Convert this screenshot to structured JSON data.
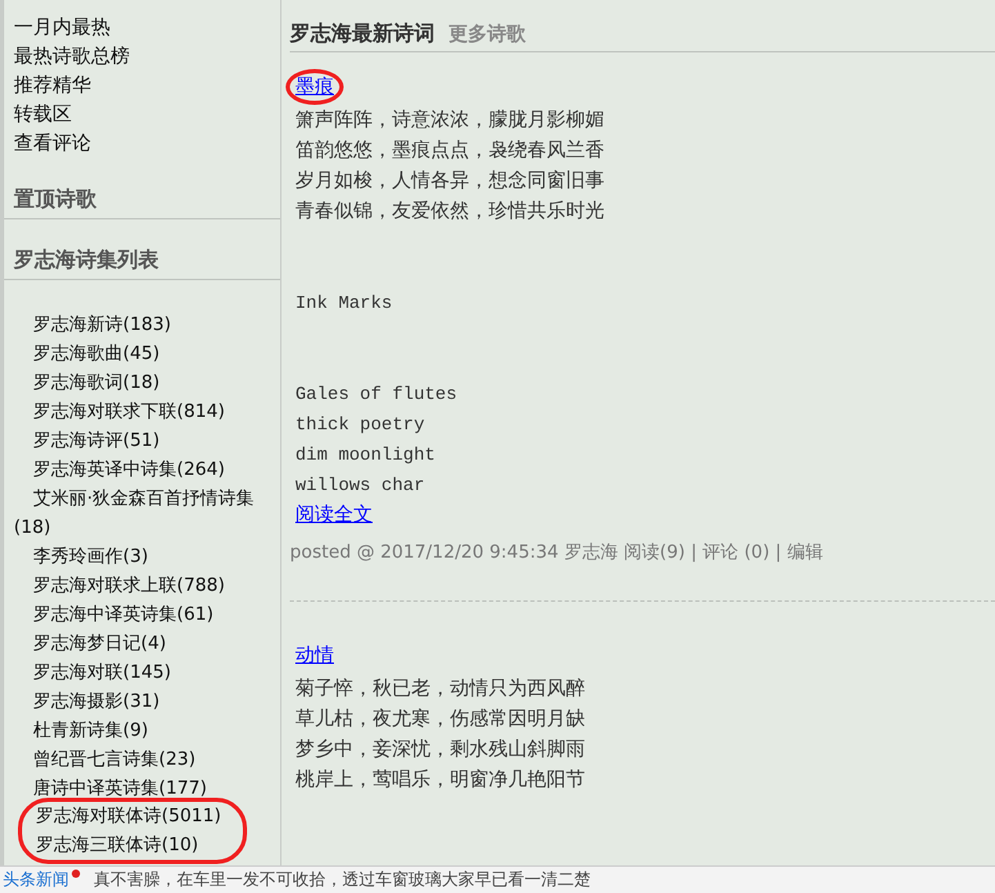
{
  "sidebar": {
    "links": [
      {
        "label": "一月内最热"
      },
      {
        "label": "最热诗歌总榜"
      },
      {
        "label": "推荐精华"
      },
      {
        "label": "转载区"
      },
      {
        "label": "查看评论"
      }
    ],
    "sections": [
      {
        "title": "置顶诗歌"
      },
      {
        "title": "罗志海诗集列表"
      }
    ],
    "collections": [
      {
        "label": "罗志海新诗(183)",
        "circled": false
      },
      {
        "label": "罗志海歌曲(45)",
        "circled": false
      },
      {
        "label": "罗志海歌词(18)",
        "circled": false
      },
      {
        "label": "罗志海对联求下联(814)",
        "circled": false
      },
      {
        "label": "罗志海诗评(51)",
        "circled": false
      },
      {
        "label": "罗志海英译中诗集(264)",
        "circled": false
      },
      {
        "label": "艾米丽·狄金森百首抒情诗集(18)",
        "circled": false
      },
      {
        "label": "李秀玲画作(3)",
        "circled": false
      },
      {
        "label": "罗志海对联求上联(788)",
        "circled": false
      },
      {
        "label": "罗志海中译英诗集(61)",
        "circled": false
      },
      {
        "label": "罗志海梦日记(4)",
        "circled": false
      },
      {
        "label": "罗志海对联(145)",
        "circled": false
      },
      {
        "label": "罗志海摄影(31)",
        "circled": false
      },
      {
        "label": "杜青新诗集(9)",
        "circled": false
      },
      {
        "label": "曾纪晋七言诗集(23)",
        "circled": false
      },
      {
        "label": "唐诗中译英诗集(177)",
        "circled": false
      },
      {
        "label": "罗志海对联体诗(5011)",
        "circled": true
      },
      {
        "label": "罗志海三联体诗(10)",
        "circled": true
      }
    ]
  },
  "main": {
    "heading": "罗志海最新诗词",
    "more": "更多诗歌",
    "posts": [
      {
        "title": "墨痕",
        "circled": true,
        "lines": [
          "箫声阵阵，诗意浓浓，朦胧月影柳媚",
          "笛韵悠悠，墨痕点点，袅绕春风兰香",
          "岁月如梭，人情各异，想念同窗旧事",
          "青春似锦，友爱依然，珍惜共乐时光"
        ],
        "translation_title": "Ink Marks",
        "translation_lines": [
          "Gales of flutes",
          "thick poetry",
          "dim moonlight",
          "willows char"
        ],
        "read_more": "阅读全文",
        "footer": "posted @ 2017/12/20 9:45:34 罗志海 阅读(9) | 评论 (0) | 编辑"
      },
      {
        "title": "动情",
        "circled": false,
        "lines": [
          "菊子悴，秋已老，动情只为西风醉",
          "草儿枯，夜尤寒，伤感常因明月缺",
          "梦乡中，妾深忧，剩水残山斜脚雨",
          "桃岸上，莺唱乐，明窗净几艳阳节"
        ]
      }
    ]
  },
  "news_ticker": {
    "label": "头条新闻",
    "unread": true,
    "headline": "真不害臊，在车里一发不可收拾，透过车窗玻璃大家早已看一清二楚"
  }
}
